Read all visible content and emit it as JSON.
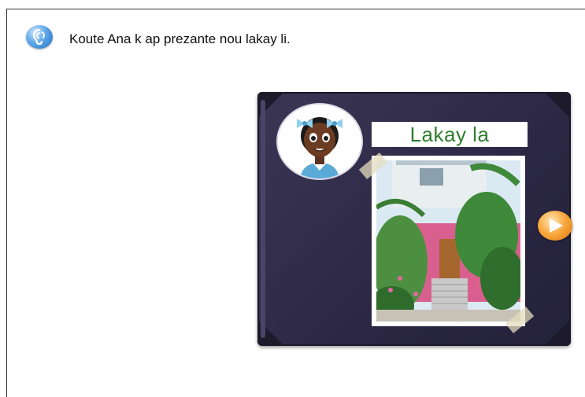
{
  "instruction": {
    "text": "Koute Ana k ap prezante nou lakay li.",
    "audio_icon": "ear-icon"
  },
  "book": {
    "title": "Lakay la",
    "photo_subject": "pink house with palm trees",
    "avatar_subject": "girl with blue hair bows"
  },
  "navigation": {
    "next_icon": "play-arrow-icon"
  },
  "colors": {
    "book_cover": "#2c2845",
    "title_text": "#2e7d2e",
    "next_button": "#f7a538",
    "audio_button": "#5ea8e8"
  }
}
